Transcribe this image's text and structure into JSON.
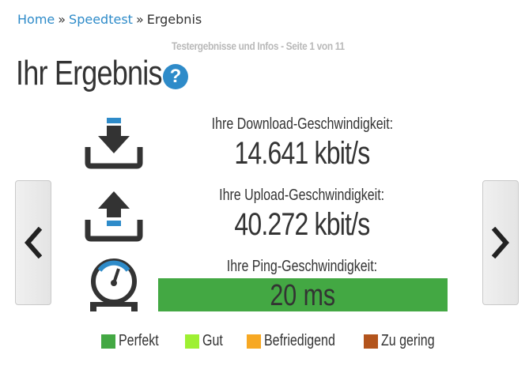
{
  "breadcrumb": {
    "home": "Home",
    "sep": "»",
    "speedtest": "Speedtest",
    "current": "Ergebnis"
  },
  "subtitle": "Testergebnisse und Infos - Seite 1 von 11",
  "title": "Ihr Ergebnis",
  "help_icon": "?",
  "nav": {
    "prev_icon": "chevron-left-icon",
    "next_icon": "chevron-right-icon"
  },
  "download": {
    "label": "Ihre Download-Geschwindigkeit:",
    "value": "14.641 kbit/s"
  },
  "upload": {
    "label": "Ihre Upload-Geschwindigkeit:",
    "value": "40.272 kbit/s"
  },
  "ping": {
    "label": "Ihre Ping-Geschwindigkeit:",
    "value": "20 ms",
    "bar_color": "#43a843"
  },
  "legend": [
    {
      "label": "Perfekt",
      "color": "#43a843"
    },
    {
      "label": "Gut",
      "color": "#9ef032"
    },
    {
      "label": "Befriedigend",
      "color": "#f7a823"
    },
    {
      "label": "Zu gering",
      "color": "#b3541c"
    }
  ],
  "colors": {
    "accent": "#2e8bc9",
    "text": "#333333"
  }
}
